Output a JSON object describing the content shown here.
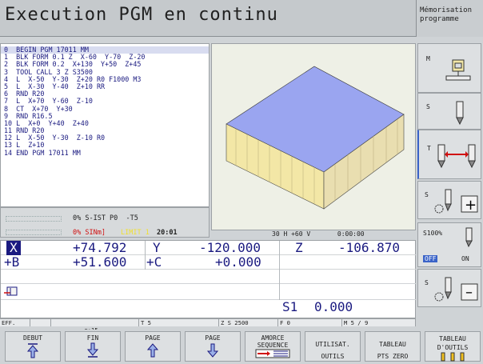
{
  "header": {
    "title": "Execution PGM en continu",
    "mode_line1": "Mémorisation",
    "mode_line2": "programme"
  },
  "program": {
    "lines": [
      "0  BEGIN PGM 17011 MM",
      "1  BLK FORM 0.1 Z  X-60  Y-70  Z-20",
      "2  BLK FORM 0.2  X+130  Y+50  Z+45",
      "3  TOOL CALL 3 Z S3500",
      "4  L  X-50  Y-30  Z+20 R0 F1000 M3",
      "5  L  X-30  Y-40  Z+10 RR",
      "6  RND R20",
      "7  L  X+70  Y-60  Z-10",
      "8  CT  X+70  Y+30",
      "9  RND R16.5",
      "10 L  X+0  Y+40  Z+40",
      "11 RND R20",
      "12 L  X-50  Y-30  Z-10 R0",
      "13 L  Z+10",
      "14 END PGM 17011 MM"
    ],
    "status_line1": "0% S-IST P0  -T5",
    "status_line2_a": "0% SINm]",
    "status_line2_b": "LIMIT 1",
    "status_line2_c": "20:01"
  },
  "graphic": {
    "status": "30 H +60 V       0:00:00"
  },
  "positions": {
    "x_label": "X",
    "x_value": "+74.792",
    "y_label": "Y",
    "y_value": "-120.000",
    "z_label": "Z",
    "z_value": "-106.870",
    "b_label": "+B",
    "b_value": "+51.600",
    "c_label": "+C",
    "c_value": "+0.000",
    "s1_label": "S1",
    "s1_value": "0.000"
  },
  "statusbar": {
    "eff": "EFF.",
    "feed": "15",
    "t": "T 5",
    "zs": "Z S 2500",
    "f": "F 0",
    "m": "M 5 / 9"
  },
  "right_softkeys": {
    "m": "M",
    "s": "S",
    "t": "T",
    "s2": "S",
    "pct": "S100%",
    "off": "OFF",
    "on": "ON",
    "s3": "S"
  },
  "bottom_softkeys": {
    "debut": "DEBUT",
    "fin": "FIN",
    "page_up": "PAGE",
    "page_down": "PAGE",
    "amorce1": "AMORCE",
    "amorce2": "SEQUENCE",
    "util1": "UTILISAT.",
    "util2": "OUTILS",
    "tab1": "TABLEAU",
    "tab2": "PTS ZERO",
    "tab3": "TABLEAU",
    "tab4": "D'OUTILS"
  },
  "colors": {
    "accent_blue": "#1a1a80",
    "limit_red": "#d01010",
    "limit_yellow": "#f0e030",
    "off_badge": "#3a63c8"
  }
}
